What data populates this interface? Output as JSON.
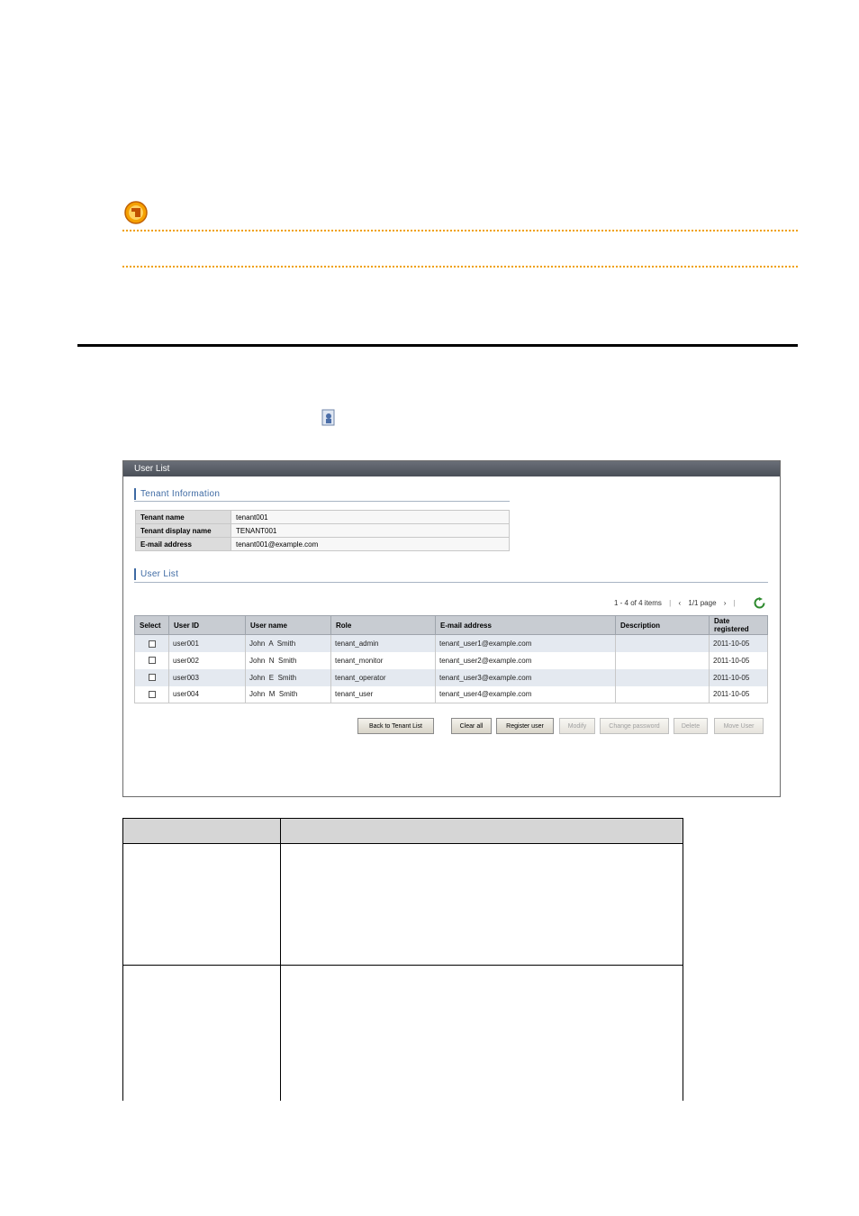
{
  "window": {
    "title": "User List"
  },
  "tenant_information": {
    "heading": "Tenant Information",
    "rows": [
      {
        "label": "Tenant name",
        "value": "tenant001"
      },
      {
        "label": "Tenant display name",
        "value": "TENANT001"
      },
      {
        "label": "E-mail address",
        "value": "tenant001@example.com"
      }
    ]
  },
  "user_list": {
    "heading": "User List",
    "pager": {
      "items": "1 - 4 of 4 items",
      "page": "1/1 page"
    },
    "columns": [
      "Select",
      "User ID",
      "User name",
      "Role",
      "E-mail address",
      "Description",
      "Date registered"
    ],
    "rows": [
      {
        "user_id": "user001",
        "user_name": "John  A  Smith",
        "role": "tenant_admin",
        "email": "tenant_user1@example.com",
        "description": "",
        "date": "2011-10-05"
      },
      {
        "user_id": "user002",
        "user_name": "John  N  Smith",
        "role": "tenant_monitor",
        "email": "tenant_user2@example.com",
        "description": "",
        "date": "2011-10-05"
      },
      {
        "user_id": "user003",
        "user_name": "John  E  Smith",
        "role": "tenant_operator",
        "email": "tenant_user3@example.com",
        "description": "",
        "date": "2011-10-05"
      },
      {
        "user_id": "user004",
        "user_name": "John  M  Smith",
        "role": "tenant_user",
        "email": "tenant_user4@example.com",
        "description": "",
        "date": "2011-10-05"
      }
    ]
  },
  "buttons": {
    "back": "Back to Tenant List",
    "clear": "Clear all",
    "register": "Register user",
    "modify": "Modify",
    "change_password": "Change password",
    "delete": "Delete",
    "move": "Move User"
  },
  "colors": {
    "caution_accent": "#f0a000",
    "section_heading": "#3e6aa3",
    "title_bar": "#4a4f58"
  },
  "icons": {
    "caution": "caution-icon",
    "document": "document-icon",
    "refresh": "refresh-icon"
  }
}
